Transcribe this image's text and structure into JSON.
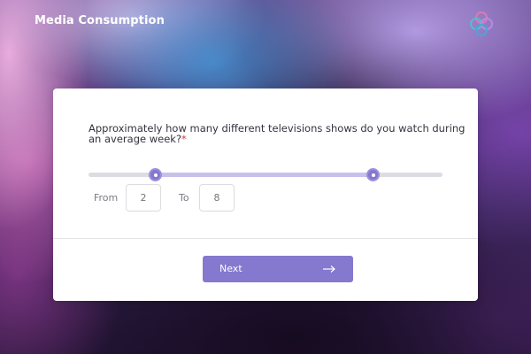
{
  "header": {
    "app_title": "Media Consumption",
    "logo_icon": "interlocking-circles-logo-icon"
  },
  "question": {
    "text": "Approximately how many different televisions shows do you watch during an average week?",
    "required_marker": "*"
  },
  "slider": {
    "from_fraction": 0.19,
    "to_fraction": 0.805,
    "from_label": "From",
    "to_label": "To",
    "from_placeholder": "2",
    "to_placeholder": "8"
  },
  "footer": {
    "next_label": "Next",
    "next_icon": "arrow-right-icon"
  },
  "colors": {
    "accent": "#8578cf",
    "range_fill": "#c9bfeb",
    "track": "#dddbe3",
    "required": "#e0334d"
  }
}
